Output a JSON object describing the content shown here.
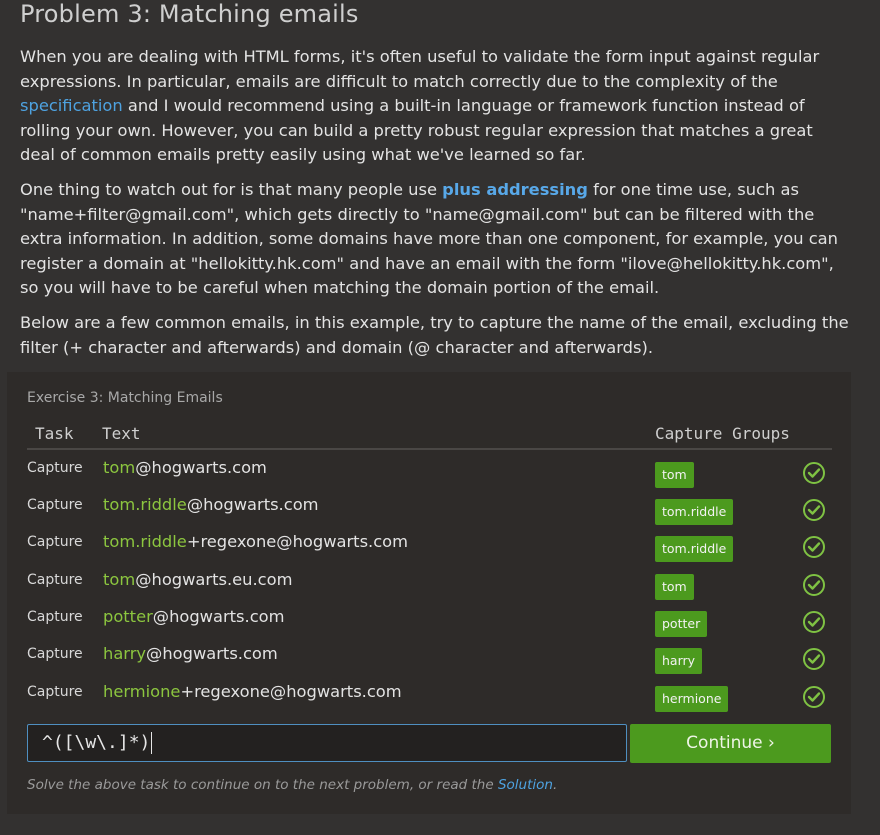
{
  "page": {
    "title": "Problem 3: Matching emails",
    "p1_a": "When you are dealing with HTML forms, it's often useful to validate the form input against regular expressions. In particular, emails are difficult to match correctly due to the complexity of the ",
    "p1_link": "specification",
    "p1_b": " and I would recommend using a built-in language or framework function instead of rolling your own. However, you can build a pretty robust regular expression that matches a great deal of common emails pretty easily using what we've learned so far.",
    "p2_a": "One thing to watch out for is that many people use ",
    "p2_link": "plus addressing",
    "p2_b": " for one time use, such as \"name+filter@gmail.com\", which gets directly to \"name@gmail.com\" but can be filtered with the extra information. In addition, some domains have more than one component, for example, you can register a domain at \"hellokitty.hk.com\" and have an email with the form \"ilove@hellokitty.hk.com\", so you will have to be careful when matching the domain portion of the email.",
    "p3": "Below are a few common emails, in this example, try to capture the name of the email, excluding the filter (+ character and afterwards) and domain (@ character and afterwards)."
  },
  "exercise": {
    "title": "Exercise 3: Matching Emails",
    "col_task": "Task",
    "col_text": "Text",
    "col_groups": "Capture Groups",
    "rows": [
      {
        "task": "Capture",
        "match": "tom",
        "rest": "@hogwarts.com",
        "group": "tom"
      },
      {
        "task": "Capture",
        "match": "tom.riddle",
        "rest": "@hogwarts.com",
        "group": "tom.riddle"
      },
      {
        "task": "Capture",
        "match": "tom.riddle",
        "rest": "+regexone@hogwarts.com",
        "group": "tom.riddle"
      },
      {
        "task": "Capture",
        "match": "tom",
        "rest": "@hogwarts.eu.com",
        "group": "tom"
      },
      {
        "task": "Capture",
        "match": "potter",
        "rest": "@hogwarts.com",
        "group": "potter"
      },
      {
        "task": "Capture",
        "match": "harry",
        "rest": "@hogwarts.com",
        "group": "harry"
      },
      {
        "task": "Capture",
        "match": "hermione",
        "rest": "+regexone@hogwarts.com",
        "group": "hermione"
      }
    ],
    "status_icon": "check-circle-icon",
    "regex_value": "^([\\w\\.]*)",
    "continue_label": "Continue ›",
    "hint_a": "Solve the above task to continue on to the next problem, or read the ",
    "hint_link": "Solution",
    "hint_b": "."
  },
  "colors": {
    "background": "#333130",
    "panel": "#2e2b29",
    "accent_green": "#4c9a1e",
    "match_green": "#8cc63f",
    "link_blue": "#4ea2e0"
  }
}
